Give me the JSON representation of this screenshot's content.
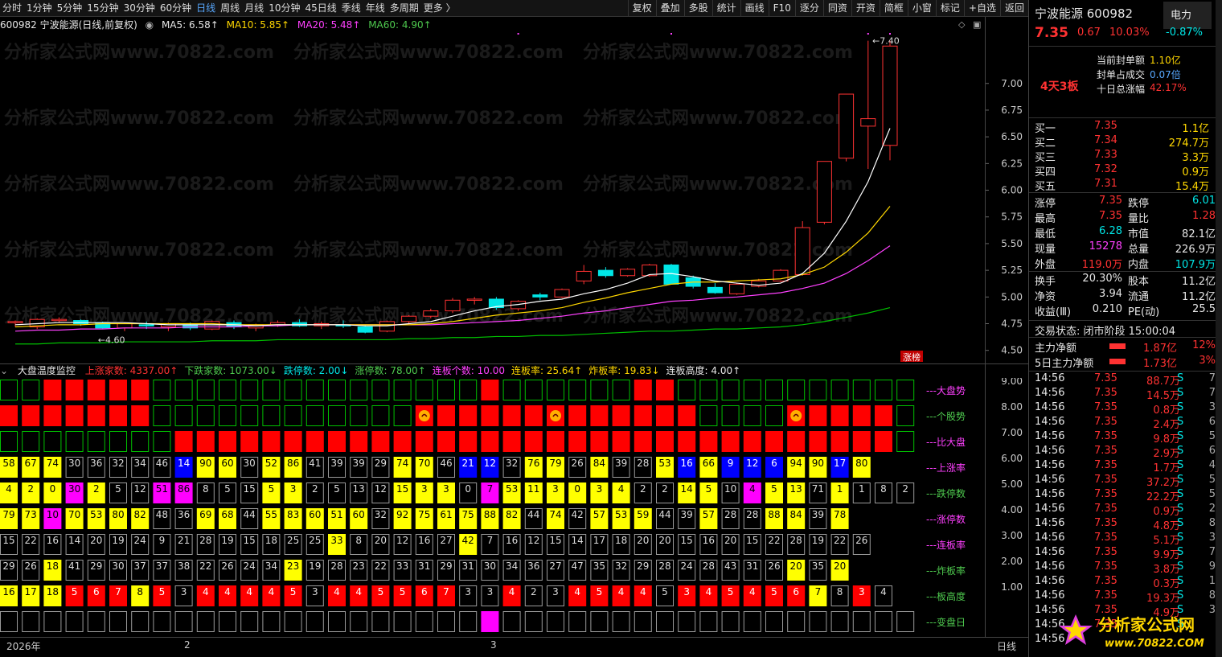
{
  "toolbar": {
    "periods": [
      "分时",
      "1分钟",
      "5分钟",
      "15分钟",
      "30分钟",
      "60分钟",
      "日线",
      "周线",
      "月线",
      "10分钟",
      "45日线",
      "季线",
      "年线",
      "多周期",
      "更多 〉"
    ],
    "active": "日线",
    "right": [
      "复权",
      "叠加",
      "多股",
      "统计",
      "画线",
      "F10",
      "逐分",
      "同资",
      "开资",
      "简框",
      "小窗",
      "标记",
      "+自选",
      "返回"
    ]
  },
  "info": {
    "code_name": "600982 宁波能源(日线,前复权)",
    "ma5": "MA5: 6.58↑",
    "ma10": "MA10: 5.85↑",
    "ma20": "MA20: 5.48↑",
    "ma60": "MA60: 4.90↑"
  },
  "watermark": "分析家公式网www.70822.com",
  "chart_data": [
    {
      "type": "candlestick",
      "title": "",
      "price_axis": {
        "ticks": [
          7.0,
          6.75,
          6.5,
          6.25,
          6.0,
          5.75,
          5.5,
          5.25,
          5.0,
          4.75,
          4.5
        ],
        "ylim": [
          4.43,
          7.45
        ]
      },
      "candles": [
        [
          4.77,
          4.78,
          4.72,
          4.77
        ],
        [
          4.72,
          4.8,
          4.7,
          4.79
        ],
        [
          4.79,
          4.81,
          4.76,
          4.79
        ],
        [
          4.78,
          4.79,
          4.73,
          4.75
        ],
        [
          4.76,
          4.77,
          4.7,
          4.71
        ],
        [
          4.71,
          4.76,
          4.68,
          4.75
        ],
        [
          4.74,
          4.77,
          4.7,
          4.73
        ],
        [
          4.72,
          4.76,
          4.68,
          4.75
        ],
        [
          4.74,
          4.76,
          4.69,
          4.71
        ],
        [
          4.7,
          4.78,
          4.69,
          4.77
        ],
        [
          4.76,
          4.78,
          4.7,
          4.72
        ],
        [
          4.71,
          4.75,
          4.68,
          4.74
        ],
        [
          4.74,
          4.78,
          4.72,
          4.76
        ],
        [
          4.76,
          4.79,
          4.72,
          4.73
        ],
        [
          4.73,
          4.77,
          4.7,
          4.75
        ],
        [
          4.74,
          4.78,
          4.71,
          4.73
        ],
        [
          4.72,
          4.74,
          4.66,
          4.67
        ],
        [
          4.68,
          4.78,
          4.67,
          4.77
        ],
        [
          4.77,
          4.83,
          4.75,
          4.82
        ],
        [
          4.82,
          4.89,
          4.8,
          4.87
        ],
        [
          4.87,
          4.99,
          4.85,
          4.97
        ],
        [
          4.97,
          5.0,
          4.93,
          4.98
        ],
        [
          4.98,
          5.0,
          4.88,
          4.9
        ],
        [
          4.89,
          4.97,
          4.87,
          4.96
        ],
        [
          5.02,
          5.04,
          4.97,
          5.0
        ],
        [
          5.0,
          5.08,
          4.99,
          5.07
        ],
        [
          5.15,
          5.3,
          5.12,
          5.24
        ],
        [
          5.25,
          5.28,
          5.18,
          5.2
        ],
        [
          5.2,
          5.27,
          5.19,
          5.26
        ],
        [
          5.2,
          5.31,
          5.19,
          5.3
        ],
        [
          5.3,
          5.31,
          5.12,
          5.12
        ],
        [
          5.18,
          5.2,
          5.08,
          5.1
        ],
        [
          5.09,
          5.13,
          5.03,
          5.04
        ],
        [
          5.03,
          5.13,
          5.02,
          5.12
        ],
        [
          5.1,
          5.17,
          5.09,
          5.15
        ],
        [
          5.15,
          5.26,
          5.14,
          5.25
        ],
        [
          5.21,
          5.71,
          5.2,
          5.65
        ],
        [
          5.7,
          6.27,
          5.68,
          6.27
        ],
        [
          6.3,
          6.9,
          6.27,
          6.9
        ],
        [
          6.6,
          7.4,
          6.2,
          6.67
        ],
        [
          6.42,
          7.4,
          6.28,
          7.35
        ]
      ],
      "ma5": [
        4.74,
        4.75,
        4.76,
        4.76,
        4.76,
        4.76,
        4.75,
        4.74,
        4.74,
        4.74,
        4.74,
        4.73,
        4.74,
        4.74,
        4.74,
        4.74,
        4.73,
        4.73,
        4.75,
        4.77,
        4.82,
        4.87,
        4.91,
        4.93,
        4.96,
        4.98,
        5.03,
        5.07,
        5.13,
        5.21,
        5.22,
        5.19,
        5.15,
        5.13,
        5.11,
        5.13,
        5.22,
        5.41,
        5.71,
        6.08,
        6.58
      ],
      "ma10": [
        4.72,
        4.73,
        4.74,
        4.74,
        4.75,
        4.75,
        4.75,
        4.75,
        4.75,
        4.75,
        4.74,
        4.74,
        4.74,
        4.74,
        4.74,
        4.74,
        4.74,
        4.74,
        4.74,
        4.75,
        4.77,
        4.8,
        4.83,
        4.85,
        4.87,
        4.9,
        4.95,
        4.99,
        5.04,
        5.08,
        5.12,
        5.14,
        5.14,
        5.15,
        5.16,
        5.17,
        5.21,
        5.28,
        5.42,
        5.6,
        5.85
      ],
      "ma20": [
        4.68,
        4.69,
        4.69,
        4.7,
        4.7,
        4.71,
        4.71,
        4.71,
        4.72,
        4.72,
        4.72,
        4.73,
        4.73,
        4.74,
        4.74,
        4.74,
        4.74,
        4.74,
        4.74,
        4.74,
        4.75,
        4.76,
        4.77,
        4.78,
        4.8,
        4.82,
        4.85,
        4.87,
        4.9,
        4.93,
        4.96,
        4.97,
        4.99,
        5.0,
        5.02,
        5.04,
        5.08,
        5.13,
        5.22,
        5.34,
        5.48
      ],
      "ma60": [
        4.56,
        4.56,
        4.57,
        4.57,
        4.57,
        4.58,
        4.58,
        4.58,
        4.58,
        4.59,
        4.59,
        4.59,
        4.6,
        4.6,
        4.6,
        4.6,
        4.6,
        4.6,
        4.61,
        4.61,
        4.62,
        4.62,
        4.63,
        4.63,
        4.64,
        4.64,
        4.65,
        4.66,
        4.67,
        4.68,
        4.68,
        4.69,
        4.7,
        4.7,
        4.71,
        4.72,
        4.74,
        4.77,
        4.81,
        4.85,
        4.9
      ],
      "annotations": {
        "high": "7.40",
        "low": "4.60",
        "tag": "涨榜"
      },
      "markers": [
        23,
        30,
        39,
        40,
        48
      ]
    },
    {
      "type": "table",
      "title": "大盘温度监控",
      "header": [
        [
          "上涨家数: 4337.00↑",
          "red"
        ],
        [
          "下跌家数: 1073.00↓",
          "grn"
        ],
        [
          "跌停数: 2.00↓",
          "cyan"
        ],
        [
          "涨停数: 78.00↑",
          "grn"
        ],
        [
          "连板个数: 10.00",
          "mag"
        ],
        [
          "连板率: 25.64↑",
          "yel"
        ],
        [
          "炸板率: 19.83↓",
          "yel"
        ],
        [
          "连板高度: 4.00↑",
          "wht"
        ]
      ],
      "axis": {
        "ticks": [
          "9.00",
          "8.00",
          "7.00",
          "6.00",
          "5.00",
          "4.00",
          "3.00",
          "2.00",
          "1.00"
        ]
      },
      "row_labels": [
        "---大盘势",
        "---个股势",
        "---比大盘",
        "---上涨率",
        "---跌停数",
        "---涨停数",
        "---连板率",
        "---炸板率",
        "---板高度",
        "---变盘日"
      ],
      "row_label_colors": [
        "#ff40ff",
        "#4ec94e",
        "#ff40ff",
        "#ff40ff",
        "#4ec94e",
        "#ff40ff",
        "#ff40ff",
        "#4ec94e",
        "#4ec94e",
        "#4ec94e"
      ],
      "icons_row2": [
        19,
        25,
        36
      ],
      "rows": [
        "GGRRRRRGGGGGGGGGGGGGGGRGGGGGGRRGGGGGGGGGG",
        "RRRRRRRGGGGGGGGGGGGRRRRRRRRRRRRRGGGGRRRRR",
        "GGGGGGGGRRRRRRRRRRRRRRRRRRRRRRRRRRRRRRRRR"
      ],
      "num_rows": [
        {
          "values": [
            58,
            67,
            74,
            30,
            36,
            32,
            34,
            46,
            14,
            90,
            60,
            30,
            52,
            86,
            41,
            39,
            39,
            29,
            74,
            70,
            46,
            21,
            12,
            32,
            76,
            79,
            26,
            84,
            39,
            28,
            53,
            16,
            66,
            9,
            12,
            6,
            94,
            90,
            17,
            80
          ],
          "colors": "YYY.....BYY.YY....YY.BB.YY.Y..YBYBBBYYBY"
        },
        {
          "values": [
            4,
            2,
            0,
            30,
            2,
            5,
            12,
            51,
            86,
            8,
            5,
            15,
            5,
            3,
            2,
            5,
            13,
            12,
            15,
            3,
            3,
            0,
            7,
            53,
            11,
            3,
            0,
            3,
            4,
            2,
            2,
            14,
            5,
            10,
            4,
            5,
            13,
            71,
            1,
            1,
            8,
            2
          ],
          "colors": "YYYMY..MM...YY....YYY.MYYYYYY..YY.MYY.Y"
        },
        {
          "values": [
            79,
            73,
            10,
            70,
            53,
            80,
            82,
            48,
            36,
            69,
            68,
            44,
            55,
            83,
            60,
            51,
            60,
            32,
            92,
            75,
            61,
            75,
            88,
            82,
            44,
            74,
            42,
            57,
            53,
            59,
            44,
            39,
            57,
            28,
            28,
            88,
            84,
            39,
            78
          ],
          "colors": "YYMYYYY..YY.YYYYY.YYYYYY.Y.YYY..Y..YY.Y"
        },
        {
          "values": [
            15,
            22,
            16,
            14,
            20,
            19,
            24,
            9,
            21,
            28,
            19,
            15,
            18,
            25,
            25,
            33,
            8,
            20,
            12,
            16,
            27,
            42,
            7,
            16,
            12,
            15,
            14,
            17,
            18,
            20,
            20,
            15,
            16,
            20,
            15,
            22,
            28,
            19,
            22,
            26
          ],
          "colors": "...............Y.....Y................"
        },
        {
          "values": [
            29,
            26,
            18,
            41,
            29,
            30,
            37,
            37,
            38,
            22,
            26,
            24,
            34,
            23,
            19,
            28,
            23,
            22,
            33,
            31,
            29,
            31,
            30,
            34,
            36,
            27,
            47,
            35,
            32,
            29,
            28,
            24,
            28,
            43,
            31,
            26,
            20,
            35,
            20
          ],
          "colors": "..Y..........Y......................Y.Y"
        },
        {
          "values": [
            16,
            17,
            18,
            5,
            6,
            7,
            8,
            5,
            3,
            4,
            4,
            4,
            4,
            5,
            3,
            4,
            4,
            5,
            5,
            6,
            7,
            3,
            3,
            4,
            2,
            3,
            4,
            5,
            4,
            4,
            5,
            3,
            4,
            5,
            4,
            5,
            6,
            7,
            8,
            3,
            4
          ],
          "colors": "YYYRRRYR.RRRRR.RRRRRR..R..RRRR.RRRRRRY.R"
        }
      ],
      "change_day": [
        22
      ]
    }
  ],
  "time_axis": {
    "labels": [
      [
        "2026年",
        8
      ],
      [
        "2",
        229
      ],
      [
        "3",
        610
      ]
    ],
    "mode": "日线"
  },
  "quote": {
    "name": "宁波能源",
    "code": "600982",
    "tag": "电力",
    "tag_pct": "-0.87%",
    "price": "7.35",
    "change": "0.67",
    "pct": "10.03%",
    "board": "4天3板",
    "seal": [
      [
        "当前封单额",
        "1.10亿",
        "yel"
      ],
      [
        "封单占成交",
        "0.07倍",
        "blu"
      ],
      [
        "十日总涨幅",
        "42.17%",
        "red"
      ]
    ],
    "bids": [
      [
        "买一",
        "7.35",
        "1.1亿"
      ],
      [
        "买二",
        "7.34",
        "274.7万"
      ],
      [
        "买三",
        "7.33",
        "3.3万"
      ],
      [
        "买四",
        "7.32",
        "0.9万"
      ],
      [
        "买五",
        "7.31",
        "15.4万"
      ]
    ],
    "stats": [
      [
        [
          "涨停",
          "7.35",
          "red"
        ],
        [
          "跌停",
          "6.01",
          "cyan"
        ]
      ],
      [
        [
          "最高",
          "7.35",
          "red"
        ],
        [
          "量比",
          "1.28",
          "red"
        ]
      ],
      [
        [
          "最低",
          "6.28",
          "cyan"
        ],
        [
          "市值",
          "82.1亿",
          "wht"
        ]
      ],
      [
        [
          "现量",
          "15278",
          "mag"
        ],
        [
          "总量",
          "226.9万",
          "wht"
        ]
      ],
      [
        [
          "外盘",
          "119.0万",
          "red"
        ],
        [
          "内盘",
          "107.9万",
          "cyan"
        ]
      ]
    ],
    "fin": [
      [
        [
          "换手",
          "20.30%"
        ],
        [
          "股本",
          "11.2亿"
        ]
      ],
      [
        [
          "净资",
          "3.94"
        ],
        [
          "流通",
          "11.2亿"
        ]
      ],
      [
        [
          "收益(Ⅲ)",
          "0.210"
        ],
        [
          "PE(动)",
          "25.5"
        ]
      ]
    ],
    "status": "交易状态: 闭市阶段 15:00:04",
    "flows": [
      [
        "主力净额",
        "1.87亿",
        "12%"
      ],
      [
        "5日主力净额",
        "1.73亿",
        "3%"
      ]
    ],
    "ticks": [
      [
        "14:56",
        "7.35",
        "88.7万",
        "S",
        "7"
      ],
      [
        "14:56",
        "7.35",
        "14.5万",
        "S",
        "7"
      ],
      [
        "14:56",
        "7.35",
        "0.8万",
        "S",
        "3"
      ],
      [
        "14:56",
        "7.35",
        "2.4万",
        "S",
        "6"
      ],
      [
        "14:56",
        "7.35",
        "9.8万",
        "S",
        "5"
      ],
      [
        "14:56",
        "7.35",
        "2.9万",
        "S",
        "6"
      ],
      [
        "14:56",
        "7.35",
        "1.7万",
        "S",
        "4"
      ],
      [
        "14:56",
        "7.35",
        "37.2万",
        "S",
        "5"
      ],
      [
        "14:56",
        "7.35",
        "22.2万",
        "S",
        "5"
      ],
      [
        "14:56",
        "7.35",
        "0.9万",
        "S",
        "2"
      ],
      [
        "14:56",
        "7.35",
        "4.8万",
        "S",
        "8"
      ],
      [
        "14:56",
        "7.35",
        "5.1万",
        "S",
        "3"
      ],
      [
        "14:56",
        "7.35",
        "9.9万",
        "S",
        "7"
      ],
      [
        "14:56",
        "7.35",
        "3.8万",
        "S",
        "9"
      ],
      [
        "14:56",
        "7.35",
        "0.3万",
        "S",
        "1"
      ],
      [
        "14:56",
        "7.35",
        "19.3万",
        "S",
        "8"
      ],
      [
        "14:56",
        "7.35",
        "4.9万",
        "S",
        "3"
      ],
      [
        "14:56",
        "7.35",
        "",
        "S",
        ""
      ],
      [
        "14:56",
        "",
        "",
        "",
        ""
      ]
    ]
  },
  "logo": {
    "cn": "分析家公式网",
    "url": "www.70822.COM"
  },
  "colors": {
    "up": "#ff3232",
    "down": "#00e6e6",
    "ma5": "#ffffff",
    "ma10": "#ffd700",
    "ma20": "#ff40ff",
    "ma60": "#00c000",
    "grid": "#303030"
  }
}
